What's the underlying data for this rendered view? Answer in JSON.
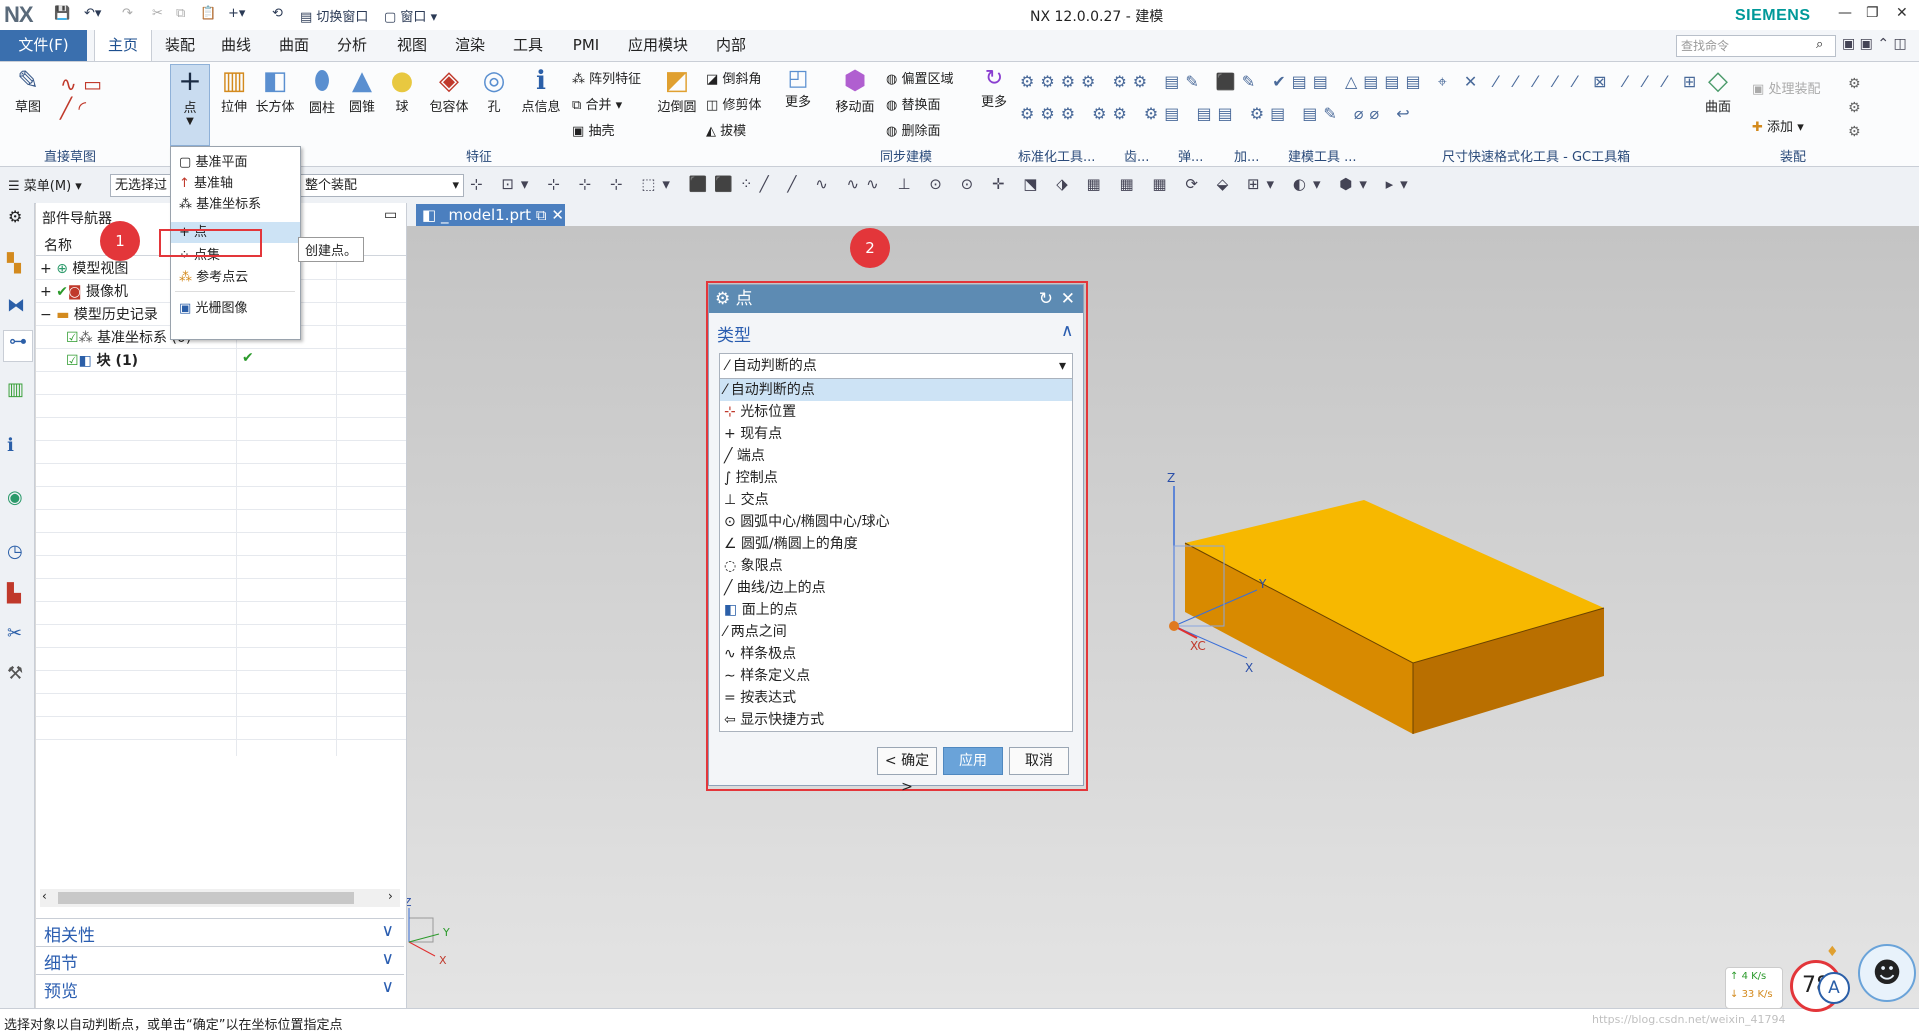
{
  "titlebar": {
    "logo": "NX",
    "switch_window": "切换窗口",
    "window_menu": "窗口",
    "title": "NX 12.0.0.27 - 建模",
    "brand": "SIEMENS"
  },
  "tabs": {
    "file": "文件(F)",
    "items": [
      "主页",
      "装配",
      "曲线",
      "曲面",
      "分析",
      "视图",
      "渲染",
      "工具",
      "PMI",
      "应用模块",
      "内部"
    ],
    "search_placeholder": "查找命令"
  },
  "ribbon": {
    "sketch": "草图",
    "point": "点",
    "extrude": "拉伸",
    "block": "长方体",
    "cylinder": "圆柱",
    "cone": "圆锥",
    "sphere": "球",
    "bounding_body": "包容体",
    "hole": "孔",
    "point_info": "点信息",
    "pattern_feature": "阵列特征",
    "unite": "合并",
    "shell": "抽壳",
    "edge_blend": "边倒圆",
    "chamfer": "倒斜角",
    "trim_body": "修剪体",
    "draft": "拔模",
    "more1": "更多",
    "move_face": "移动面",
    "offset_region": "偏置区域",
    "replace_face": "替换面",
    "delete_face": "删除面",
    "more2": "更多",
    "surface": "曲面",
    "assembly_tool": "处理装配",
    "add": "添加",
    "groups": {
      "direct_sketch": "直接草图",
      "feature": "特征",
      "sync_modeling": "同步建模",
      "standardization": "标准化工具...",
      "gear": "齿...",
      "spring": "弹...",
      "machining": "加...",
      "modeling_tools": "建模工具 ...",
      "dim_format": "尺寸快速格式化工具 - GC工具箱",
      "assembly": "装配"
    }
  },
  "toolbar2": {
    "menu": "菜单(M)",
    "filter": "无选择过",
    "scope": "整个装配"
  },
  "point_menu": {
    "items": [
      "基准平面",
      "基准轴",
      "基准坐标系",
      "点",
      "点集",
      "参考点云",
      "光栅图像"
    ],
    "tooltip": "创建点。"
  },
  "navigator": {
    "title": "部件导航器",
    "col_name": "名称",
    "rows": [
      "模型视图",
      "摄像机",
      "模型历史记录",
      "基准坐标系 (0)",
      "块 (1)"
    ],
    "panels": [
      "相关性",
      "细节",
      "预览"
    ]
  },
  "graphics": {
    "tab": "_model1.prt",
    "triad": {
      "z": "Z",
      "y": "Y",
      "x": "X",
      "xc": "XC"
    }
  },
  "dialog": {
    "title": "点",
    "section": "类型",
    "selected": "自动判断的点",
    "options": [
      "自动判断的点",
      "光标位置",
      "现有点",
      "端点",
      "控制点",
      "交点",
      "圆弧中心/椭圆中心/球心",
      "圆弧/椭圆上的角度",
      "象限点",
      "曲线/边上的点",
      "面上的点",
      "两点之间",
      "样条极点",
      "样条定义点",
      "按表达式",
      "显示快捷方式"
    ],
    "ok": "< 确定 >",
    "apply": "应用",
    "cancel": "取消"
  },
  "annotations": {
    "one": "1",
    "two": "2"
  },
  "status": {
    "message": "选择对象以自动判断点，或单击“确定”以在坐标位置指定点",
    "net_up": "4  K/s",
    "net_down": "33  K/s",
    "badge": "78",
    "watermark": "https://blog.csdn.net/weixin_41794"
  },
  "colors": {
    "accent": "#3a6fae",
    "dialog_title": "#5d8bb3",
    "highlight": "#e3363a",
    "block_top": "#f7b800",
    "block_side": "#d88a00"
  }
}
